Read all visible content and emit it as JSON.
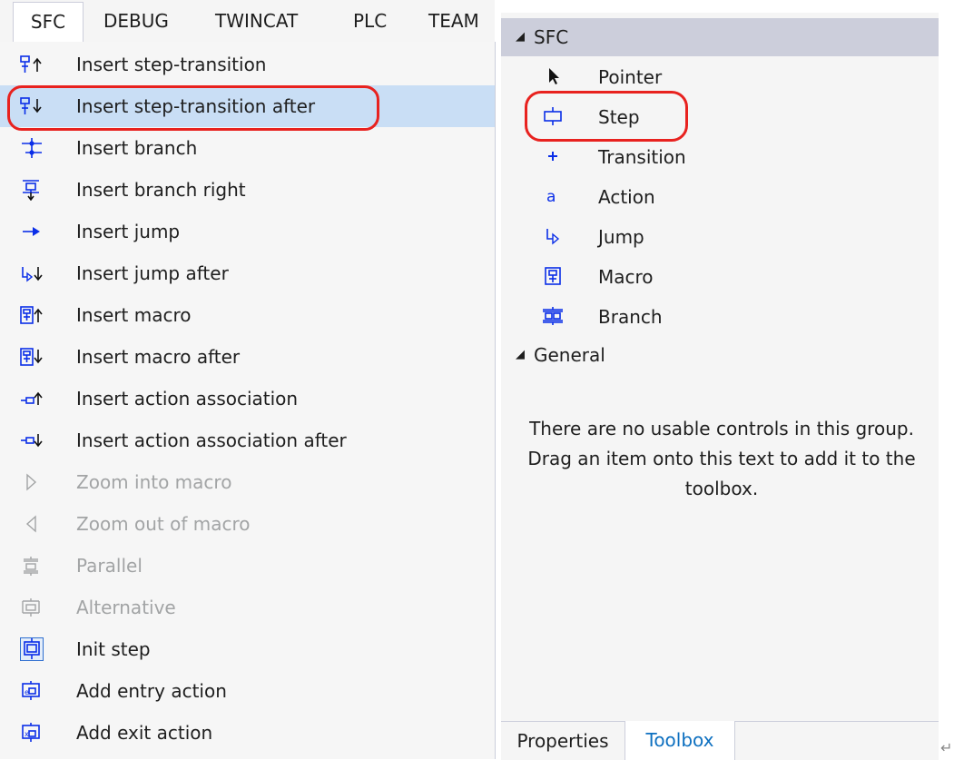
{
  "menubar": {
    "tabs": [
      "SFC",
      "DEBUG",
      "TWINCAT",
      "PLC",
      "TEAM"
    ],
    "active": "SFC"
  },
  "menu": {
    "items": [
      {
        "label": "Insert step-transition",
        "icon": "insert-step-transition-icon",
        "enabled": true
      },
      {
        "label": "Insert step-transition after",
        "icon": "insert-step-transition-after-icon",
        "enabled": true,
        "highlighted": true
      },
      {
        "label": "Insert branch",
        "icon": "insert-branch-icon",
        "enabled": true
      },
      {
        "label": "Insert branch right",
        "icon": "insert-branch-right-icon",
        "enabled": true
      },
      {
        "label": "Insert jump",
        "icon": "insert-jump-icon",
        "enabled": true
      },
      {
        "label": "Insert jump after",
        "icon": "insert-jump-after-icon",
        "enabled": true
      },
      {
        "label": "Insert macro",
        "icon": "insert-macro-icon",
        "enabled": true
      },
      {
        "label": "Insert macro after",
        "icon": "insert-macro-after-icon",
        "enabled": true
      },
      {
        "label": "Insert action association",
        "icon": "insert-action-association-icon",
        "enabled": true
      },
      {
        "label": "Insert action association after",
        "icon": "insert-action-association-after-icon",
        "enabled": true
      },
      {
        "label": "Zoom into macro",
        "icon": "zoom-into-macro-icon",
        "enabled": false
      },
      {
        "label": "Zoom out of macro",
        "icon": "zoom-out-of-macro-icon",
        "enabled": false
      },
      {
        "label": "Parallel",
        "icon": "parallel-icon",
        "enabled": false
      },
      {
        "label": "Alternative",
        "icon": "alternative-icon",
        "enabled": false
      },
      {
        "label": "Init step",
        "icon": "init-step-icon",
        "enabled": true
      },
      {
        "label": "Add entry action",
        "icon": "add-entry-action-icon",
        "enabled": true
      },
      {
        "label": "Add exit action",
        "icon": "add-exit-action-icon",
        "enabled": true
      }
    ]
  },
  "toolbox": {
    "groups": [
      {
        "name": "SFC",
        "expand_glyph": "◢",
        "items": [
          {
            "label": "Pointer",
            "icon": "pointer-icon"
          },
          {
            "label": "Step",
            "icon": "step-icon"
          },
          {
            "label": "Transition",
            "icon": "transition-icon"
          },
          {
            "label": "Action",
            "icon": "action-icon"
          },
          {
            "label": "Jump",
            "icon": "jump-icon"
          },
          {
            "label": "Macro",
            "icon": "macro-icon"
          },
          {
            "label": "Branch",
            "icon": "branch-icon"
          }
        ]
      },
      {
        "name": "General",
        "expand_glyph": "◢",
        "empty_message": "There are no usable controls in this group. Drag an item onto this text to add it to the toolbox."
      }
    ]
  },
  "bottom_tabs": {
    "properties": "Properties",
    "toolbox": "Toolbox",
    "active": "Toolbox"
  },
  "colors": {
    "icon_blue": "#0a2ee8",
    "highlight": "#c9def5",
    "selected_group": "#cccedb",
    "annotation_red": "#e8221f",
    "active_tab_text": "#0e70c0",
    "disabled_text": "#a2a4a5"
  }
}
